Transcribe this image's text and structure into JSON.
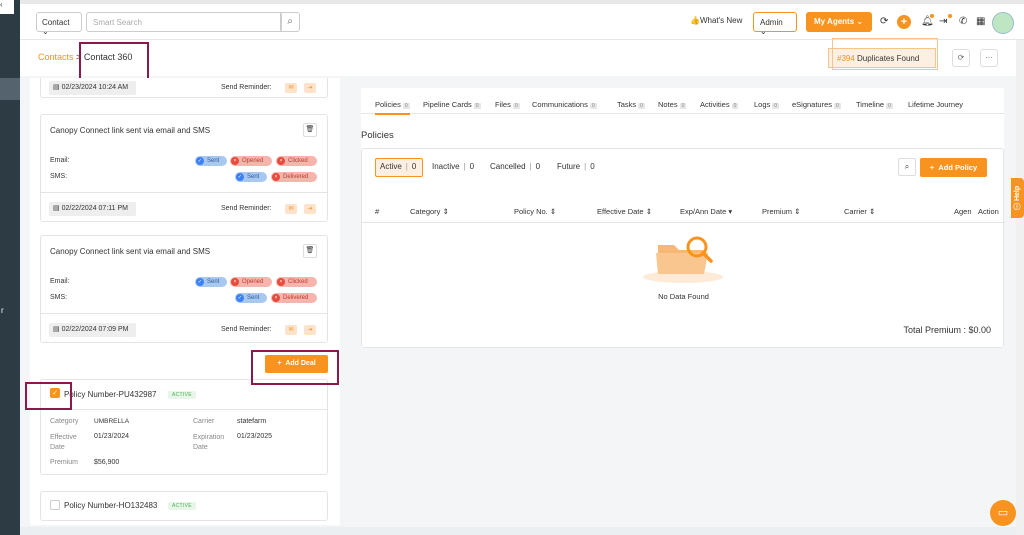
{
  "topbar": {
    "contact_select": "Contact",
    "search_placeholder": "Smart Search",
    "whats_new": "What's New",
    "admin": "Admin",
    "my_agents": "My Agents"
  },
  "breadcrumb": {
    "parent": "Contacts",
    "separator": ">",
    "current": "Contact 360"
  },
  "duplicates": {
    "count": "#394",
    "label": "Duplicates Found"
  },
  "left": {
    "partial_date": "02/23/2024 10:24 AM",
    "partial_reminder": "Send Reminder:",
    "cards": [
      {
        "title": "Canopy Connect link sent via email and SMS",
        "email_label": "Email:",
        "sms_label": "SMS:",
        "email_statuses": [
          "Sent",
          "Opened",
          "Clicked"
        ],
        "sms_statuses": [
          "Sent",
          "Delivered"
        ],
        "date": "02/22/2024 07:11 PM",
        "reminder": "Send Reminder:"
      },
      {
        "title": "Canopy Connect link sent via email and SMS",
        "email_label": "Email:",
        "sms_label": "SMS:",
        "email_statuses": [
          "Sent",
          "Opened",
          "Clicked"
        ],
        "sms_statuses": [
          "Sent",
          "Delivered"
        ],
        "date": "02/22/2024 07:09 PM",
        "reminder": "Send Reminder:"
      }
    ],
    "add_deal": "Add Deal",
    "policies": [
      {
        "number": "Policy Number-PU432987",
        "status": "ACTIVE",
        "category_label": "Category",
        "category": "UMBRELLA",
        "carrier_label": "Carrier",
        "carrier": "statefarm",
        "effective_label": "Effective Date",
        "effective": "01/23/2024",
        "expiration_label": "Expiration Date",
        "expiration": "01/23/2025",
        "premium_label": "Premium",
        "premium": "$56,900"
      },
      {
        "number": "Policy Number-HO132483",
        "status": "ACTIVE"
      }
    ]
  },
  "main": {
    "tabs": [
      {
        "label": "Policies",
        "count": "0"
      },
      {
        "label": "Pipeline Cards",
        "count": "0"
      },
      {
        "label": "Files",
        "count": "0"
      },
      {
        "label": "Communications",
        "count": "0"
      },
      {
        "label": "Tasks",
        "count": "0"
      },
      {
        "label": "Notes",
        "count": "0"
      },
      {
        "label": "Activities",
        "count": "0"
      },
      {
        "label": "Logs",
        "count": "0"
      },
      {
        "label": "eSignatures",
        "count": "0"
      },
      {
        "label": "Timeline",
        "count": "0"
      },
      {
        "label": "Lifetime Journey",
        "count": ""
      }
    ],
    "title": "Policies",
    "filters": [
      {
        "label": "Active",
        "count": "0"
      },
      {
        "label": "Inactive",
        "count": "0"
      },
      {
        "label": "Cancelled",
        "count": "0"
      },
      {
        "label": "Future",
        "count": "0"
      }
    ],
    "add_policy": "Add Policy",
    "columns": [
      "#",
      "Category",
      "Policy No.",
      "Effective Date",
      "Exp/Ann Date",
      "Premium",
      "Carrier",
      "Agen",
      "Action"
    ],
    "no_data": "No Data Found",
    "total": "Total Premium : $0.00"
  },
  "help": "Help",
  "sidebar_stray": "r",
  "colors": {
    "accent": "#f7931e",
    "highlight_box": "#8b1a4a",
    "sidebar": "#2d3b45"
  }
}
